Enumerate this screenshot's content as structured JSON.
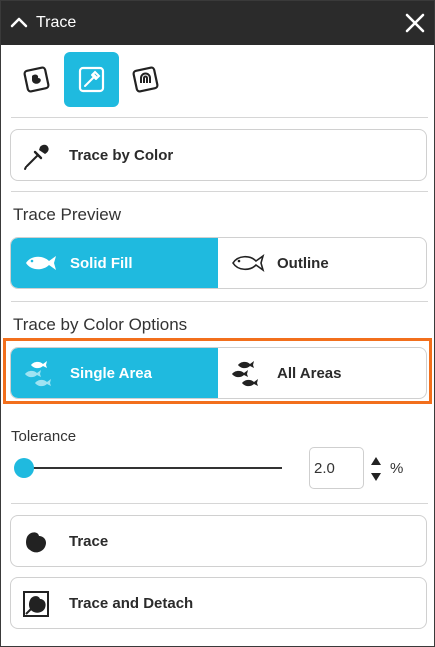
{
  "panel": {
    "title": "Trace",
    "close_label": "×"
  },
  "modes": [
    {
      "name": "trace-image",
      "icon": "image-trace-icon",
      "active": false
    },
    {
      "name": "trace-by-color",
      "icon": "eyedropper-icon",
      "active": true
    },
    {
      "name": "trace-outline",
      "icon": "magnet-trace-icon",
      "active": false
    }
  ],
  "method": {
    "label": "Trace by Color",
    "icon": "eyedropper-icon"
  },
  "preview": {
    "title": "Trace Preview",
    "options": [
      {
        "label": "Solid Fill",
        "icon": "fish-solid-icon",
        "selected": true
      },
      {
        "label": "Outline",
        "icon": "fish-outline-icon",
        "selected": false
      }
    ]
  },
  "color_options": {
    "title": "Trace by Color Options",
    "options": [
      {
        "label": "Single Area",
        "icon": "single-area-fish-icon",
        "selected": true
      },
      {
        "label": "All Areas",
        "icon": "all-areas-fish-icon",
        "selected": false
      }
    ]
  },
  "tolerance": {
    "label": "Tolerance",
    "value": "2.0",
    "unit": "%",
    "slider_fraction": 0.02
  },
  "actions": {
    "trace_label": "Trace",
    "trace_detach_label": "Trace and Detach"
  },
  "colors": {
    "accent": "#1fbadf",
    "titlebar": "#2b2b2b",
    "highlight": "#f26f1c"
  }
}
